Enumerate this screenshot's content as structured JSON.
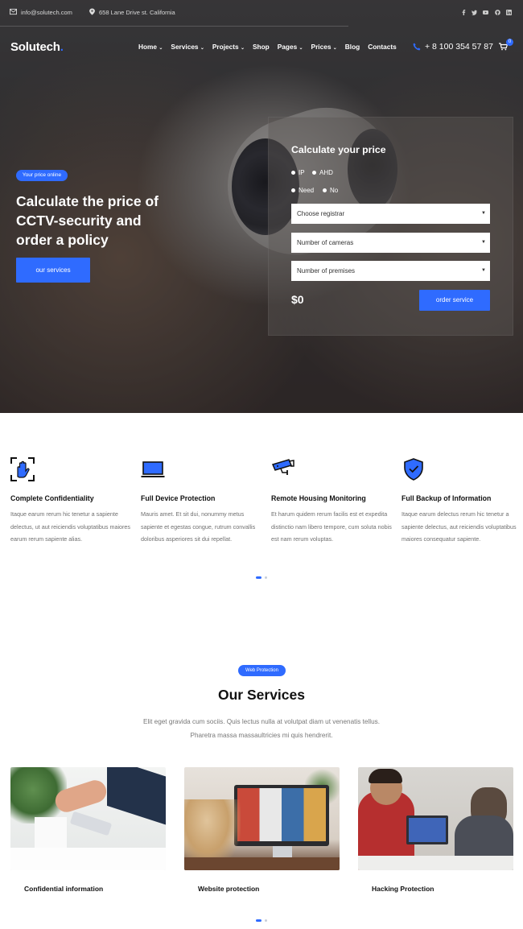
{
  "topbar": {
    "email": "info@solutech.com",
    "address": "658 Lane Drive st. California",
    "social": [
      "facebook-icon",
      "twitter-icon",
      "youtube-icon",
      "github-icon",
      "linkedin-icon"
    ]
  },
  "header": {
    "logo": "Solutech",
    "logo_dot": ".",
    "nav": [
      "Home",
      "Services",
      "Projects",
      "Shop",
      "Pages",
      "Prices",
      "Blog",
      "Contacts"
    ],
    "phone": "+ 8 100 354 57 87",
    "cart_count": "0"
  },
  "hero": {
    "badge": "Your price online",
    "title": "Calculate the price of CCTV-security and order a policy",
    "button": "our services"
  },
  "calculator": {
    "title": "Calculate your price",
    "radio_row1": [
      "IP",
      "AHD"
    ],
    "radio_row2": [
      "Need",
      "No"
    ],
    "selects": [
      "Choose registrar",
      "Number of cameras",
      "Number of premises"
    ],
    "price": "$0",
    "order_button": "order service"
  },
  "features": [
    {
      "icon": "hand-scan-icon",
      "title": "Complete Confidentiality",
      "text": "Itaque earum rerum hic tenetur a sapiente delectus, ut aut reiciendis voluptatibus maiores earum rerum sapiente alias."
    },
    {
      "icon": "laptop-icon",
      "title": "Full Device Protection",
      "text": "Mauris amet. Et sit dui, nonummy metus sapiente et egestas congue, rutrum convallis doloribus asperiores sit dui repellat."
    },
    {
      "icon": "security-camera-icon",
      "title": "Remote Housing Monitoring",
      "text": "Et harum quidem rerum facilis est et expedita distinctio nam libero tempore, cum soluta nobis est nam rerum voluptas."
    },
    {
      "icon": "shield-check-icon",
      "title": "Full Backup of Information",
      "text": "Itaque earum delectus rerum hic tenetur a sapiente delectus, aut reiciendis voluptatibus maiores consequatur sapiente."
    }
  ],
  "services": {
    "badge": "Web Protection",
    "title": "Our Services",
    "subtitle_line1": "Elit eget gravida cum sociis. Quis lectus nulla at volutpat diam ut venenatis tellus.",
    "subtitle_line2": "Pharetra massa massaultricies mi quis hendrerit.",
    "cards": [
      {
        "caption": "Confidential information"
      },
      {
        "caption": "Website protection"
      },
      {
        "caption": "Hacking Protection"
      }
    ]
  },
  "colors": {
    "accent": "#2f6bff",
    "dark_text": "#111111",
    "muted_text": "#6f6f6f"
  }
}
